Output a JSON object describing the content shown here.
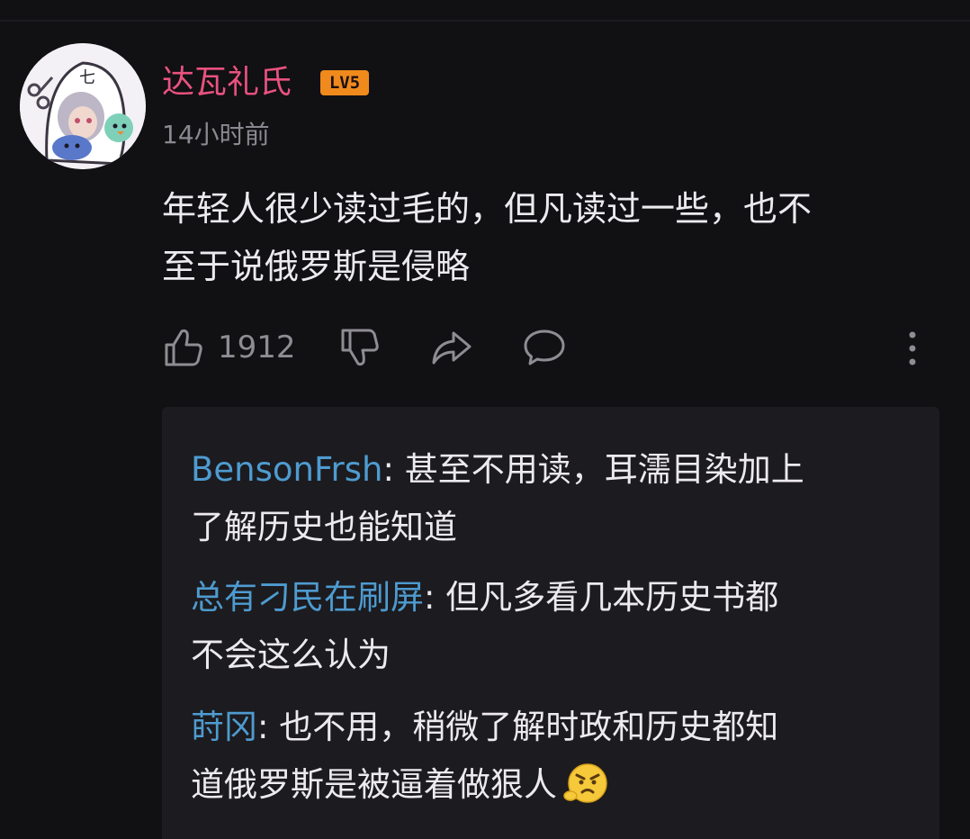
{
  "comment": {
    "username": "达瓦礼氏",
    "level": "LV5",
    "timestamp": "14小时前",
    "text_line1": "年轻人很少读过毛的，但凡读过一些，也不",
    "text_line2": "至于说俄罗斯是侵略",
    "like_count": "1912"
  },
  "replies": [
    {
      "author": "BensonFrsh",
      "separator": ": ",
      "text_line1": "甚至不用读，耳濡目染加上",
      "text_line2": "了解历史也能知道"
    },
    {
      "author": "总有刁民在刷屏",
      "separator": ": ",
      "text_line1": "但凡多看几本历史书都",
      "text_line2": "不会这么认为"
    },
    {
      "author": "莳冈",
      "separator": ": ",
      "text_line1": "也不用，稍微了解时政和历史都知",
      "text_line2": "道俄罗斯是被逼着做狠人"
    }
  ],
  "icons": {
    "like": "thumbs-up-icon",
    "dislike": "thumbs-down-icon",
    "share": "share-arrow-icon",
    "reply": "comment-bubble-icon",
    "more": "more-vertical-icon",
    "emoji": "angry-face-emoji-icon"
  },
  "colors": {
    "background": "#111013",
    "username": "#e9527f",
    "level_badge": "#f08a1c",
    "reply_author": "#4e9bd0",
    "text": "#eceaee",
    "muted": "#8a8990",
    "reply_box": "#1c1b1f"
  }
}
